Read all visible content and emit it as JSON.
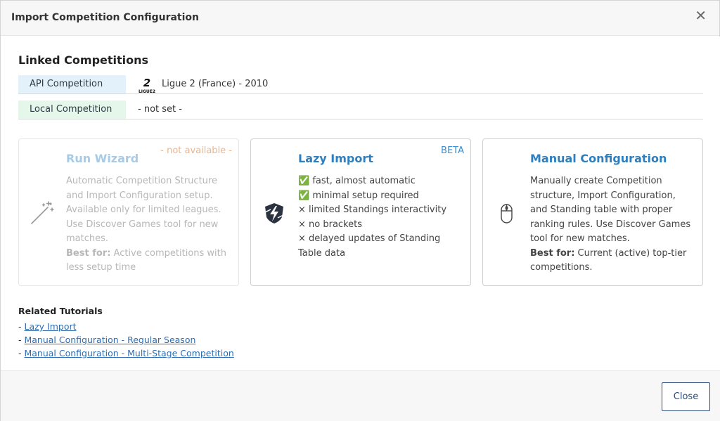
{
  "modal": {
    "title": "Import Competition Configuration",
    "close_icon": "close-icon"
  },
  "linked": {
    "heading": "Linked Competitions",
    "api_label": "API Competition",
    "api_value": "Ligue 2 (France) - 2010",
    "local_label": "Local Competition",
    "local_value": "- not set -"
  },
  "cards": {
    "wizard": {
      "title": "Run Wizard",
      "tag": "- not available -",
      "lines": [
        "Automatic Competition Structure",
        "and Import Configuration setup.",
        "Available only for limited leagues.",
        "Use Discover Games tool for new",
        "matches."
      ],
      "best_for_label": "Best for:",
      "best_for_text": " Active competitions with",
      "best_for_text2": "less setup time",
      "icon": "magic-wand-icon"
    },
    "lazy": {
      "title": "Lazy Import",
      "tag": "BETA",
      "lines": [
        "✅ fast, almost automatic",
        "✅ minimal setup required",
        "× limited Standings interactivity",
        "× no brackets",
        "× delayed updates of Standing",
        "Table data"
      ],
      "icon": "lightning-shield-icon"
    },
    "manual": {
      "title": "Manual Configuration",
      "lines": [
        "Manually create Competition",
        "structure, Import Configuration,",
        "and Standing table with proper",
        "ranking rules. Use Discover Games",
        "tool for new matches."
      ],
      "best_for_label": "Best for:",
      "best_for_text": " Current (active) top-tier",
      "best_for_text2": "competitions.",
      "icon": "mouse-icon"
    }
  },
  "tutorials": {
    "heading": "Related Tutorials",
    "prefix": "- ",
    "items": [
      "Lazy Import",
      "Manual Configuration - Regular Season",
      "Manual Configuration - Multi-Stage Competition"
    ]
  },
  "footer": {
    "close_label": "Close"
  },
  "colors": {
    "accent": "#2d7fbf",
    "api_bg": "#e3f1fb",
    "local_bg": "#e4f7ea",
    "unavailable": "#f0b48a"
  }
}
